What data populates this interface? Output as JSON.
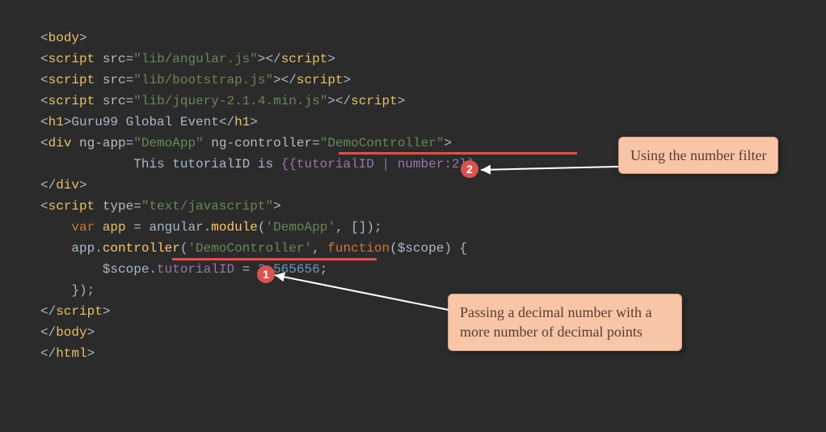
{
  "code": {
    "l1": {
      "o": "<",
      "t": "body",
      "c": ">"
    },
    "l2": {
      "o": "<",
      "t": "script",
      "sp": " ",
      "a": "src",
      "eq": "=",
      "q1": "\"",
      "v": "lib/angular.js",
      "q2": "\"",
      "c1": ">",
      "o2": "</",
      "t2": "script",
      "c2": ">"
    },
    "l3": {
      "o": "<",
      "t": "script",
      "sp": " ",
      "a": "src",
      "eq": "=",
      "q1": "\"",
      "v": "lib/bootstrap.js",
      "q2": "\"",
      "c1": ">",
      "o2": "</",
      "t2": "script",
      "c2": ">"
    },
    "l4": {
      "o": "<",
      "t": "script",
      "sp": " ",
      "a": "src",
      "eq": "=",
      "q1": "\"",
      "v": "lib/jquery-2.1.4.min.js",
      "q2": "\"",
      "c1": ">",
      "o2": "</",
      "t2": "script",
      "c2": ">"
    },
    "l5": {
      "o": "<",
      "t": "h1",
      "c1": ">",
      "txt": "Guru99 Global Event",
      "o2": "</",
      "t2": "h1",
      "c2": ">"
    },
    "l6": {
      "o": "<",
      "t": "div",
      "sp1": " ",
      "a1": "ng-app",
      "eq1": "=",
      "q1": "\"",
      "v1": "DemoApp",
      "q2": "\"",
      "sp2": " ",
      "a2": "ng-controller",
      "eq2": "=",
      "q3": "\"",
      "v2": "DemoController",
      "q4": "\"",
      "c": ">"
    },
    "l7": {
      "indent": "            ",
      "t1": "This tutorialID is ",
      "b1": "{{",
      "id": "tutorialID",
      "sp": " ",
      "pipe": "|",
      "sp2": " ",
      "filt": "number:2",
      "b2": "}}"
    },
    "l8": {
      "o": "</",
      "t": "div",
      "c": ">"
    },
    "l9": {
      "o": "<",
      "t": "script",
      "sp": " ",
      "a": "type",
      "eq": "=",
      "q1": "\"",
      "v": "text/javascript",
      "q2": "\"",
      "c": ">"
    },
    "l10": {
      "indent": "    ",
      "kw": "var",
      "sp": " ",
      "name": "app",
      "sp2": " ",
      "eq": "=",
      "sp3": " ",
      "obj": "angular",
      "dot": ".",
      "fn": "module",
      "p1": "(",
      "s1": "'DemoApp'",
      "cm": ",",
      "sp4": " ",
      "arr": "[]",
      "p2": ")",
      "sc": ";"
    },
    "l11": {
      "indent": "    ",
      "obj": "app",
      "dot": ".",
      "fn": "controller",
      "p1": "(",
      "s1": "'DemoController'",
      "cm": ",",
      "sp": " ",
      "kw": "function",
      "p2": "(",
      "arg": "$scope",
      "p3": ")",
      "sp2": " ",
      "br": "{"
    },
    "l12": {
      "indent": "        ",
      "obj": "$scope",
      "dot": ".",
      "prop": "tutorialID",
      "sp": " ",
      "eq": "=",
      "sp2": " ",
      "num": "3.565656",
      "sc": ";"
    },
    "l13": {
      "indent": "    ",
      "br": "})",
      "sc": ";"
    },
    "l14": {
      "o": "</",
      "t": "script",
      "c": ">"
    },
    "l15": {
      "o": "</",
      "t": "body",
      "c": ">"
    },
    "l16": {
      "o": "</",
      "t": "html",
      "c": ">"
    }
  },
  "annotations": {
    "badge1": "1",
    "badge2": "2",
    "callout1": "Using the number filter",
    "callout2": "Passing a decimal number with a more number of decimal points"
  }
}
